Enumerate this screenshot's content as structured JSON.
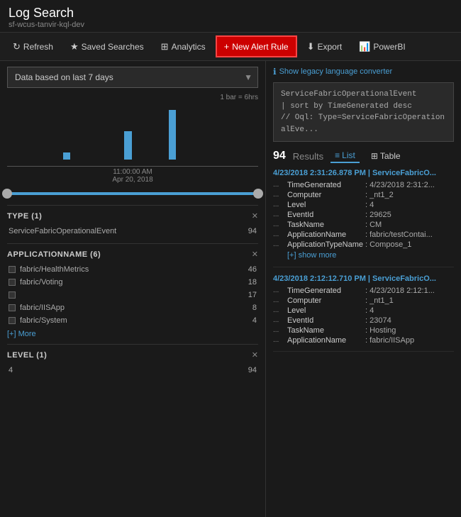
{
  "app": {
    "title": "Log Search",
    "subtitle": "sf-wcus-tanvir-kql-dev"
  },
  "toolbar": {
    "refresh_label": "Refresh",
    "saved_searches_label": "Saved Searches",
    "analytics_label": "Analytics",
    "new_alert_label": "New Alert Rule",
    "export_label": "Export",
    "powerbi_label": "PowerBI"
  },
  "left_panel": {
    "date_filter": {
      "value": "Data based on last 7 days",
      "placeholder": "Data based on last 7 days"
    },
    "chart": {
      "bar_label": "1 bar = 6hrs",
      "time_label": "11:00:00 AM",
      "date_label": "Apr 20, 2018",
      "bars": [
        0,
        0,
        0,
        0,
        0,
        0,
        5,
        0,
        0,
        0,
        0,
        0,
        0,
        20,
        0,
        0,
        0,
        0,
        35,
        0,
        0,
        0,
        0,
        0,
        0,
        0,
        0,
        0
      ]
    },
    "type_filter": {
      "title": "TYPE  (1)",
      "items": [
        {
          "name": "ServiceFabricOperationalEvent",
          "count": 94
        }
      ]
    },
    "application_filter": {
      "title": "APPLICATIONNAME  (6)",
      "items": [
        {
          "name": "fabric/HealthMetrics",
          "count": 46
        },
        {
          "name": "fabric/Voting",
          "count": 18
        },
        {
          "name": "",
          "count": 17
        },
        {
          "name": "fabric/IISApp",
          "count": 8
        },
        {
          "name": "fabric/System",
          "count": 4
        }
      ],
      "show_more_label": "[+] More"
    },
    "level_filter": {
      "title": "LEVEL  (1)",
      "items": [
        {
          "name": "4",
          "count": 94
        }
      ]
    }
  },
  "right_panel": {
    "legacy_label": "Show legacy language converter",
    "query": "ServiceFabricOperationalEvent\n| sort by TimeGenerated desc\n// Oql: Type=ServiceFabricOperationalEve...",
    "results_count": "94",
    "results_label": "Results",
    "view_list": "List",
    "view_table": "Table",
    "results": [
      {
        "timestamp": "4/23/2018 2:31:26.878 PM | ServiceFabricO...",
        "fields": [
          {
            "name": "TimeGenerated",
            "value": "4/23/2018 2:31:2..."
          },
          {
            "name": "Computer",
            "value": ": _nt1_2"
          },
          {
            "name": "Level",
            "value": ": 4"
          },
          {
            "name": "EventId",
            "value": ": 29625"
          },
          {
            "name": "TaskName",
            "value": ": CM"
          },
          {
            "name": "ApplicationName",
            "value": ": fabric/testContai..."
          },
          {
            "name": "ApplicationTypeName",
            "value": ": Compose_1"
          }
        ],
        "show_more": "[+] show more"
      },
      {
        "timestamp": "4/23/2018 2:12:12.710 PM | ServiceFabricO...",
        "fields": [
          {
            "name": "TimeGenerated",
            "value": "4/23/2018 2:12:1..."
          },
          {
            "name": "Computer",
            "value": ": _nt1_1"
          },
          {
            "name": "Level",
            "value": ": 4"
          },
          {
            "name": "EventId",
            "value": ": 23074"
          },
          {
            "name": "TaskName",
            "value": ": Hosting"
          },
          {
            "name": "ApplicationName",
            "value": ": fabric/IISApp"
          }
        ]
      }
    ]
  }
}
